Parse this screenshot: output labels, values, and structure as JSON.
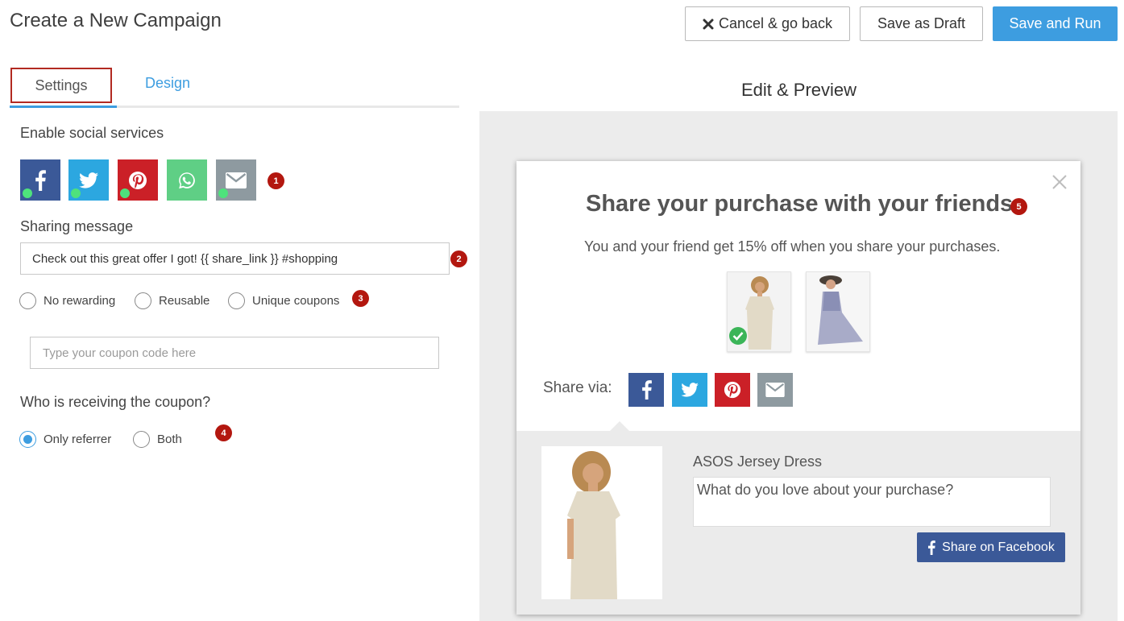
{
  "page": {
    "title": "Create a New Campaign"
  },
  "header": {
    "cancel_label": "Cancel & go back",
    "draft_label": "Save as Draft",
    "run_label": "Save and Run"
  },
  "tabs": [
    {
      "label": "Settings",
      "active": true
    },
    {
      "label": "Design",
      "active": false
    }
  ],
  "settings": {
    "social_label": "Enable social services",
    "social_services": [
      {
        "name": "facebook",
        "icon": "facebook-icon",
        "color": "#3b5998",
        "enabled": true
      },
      {
        "name": "twitter",
        "icon": "twitter-icon",
        "color": "#2ca7e0",
        "enabled": true
      },
      {
        "name": "pinterest",
        "icon": "pinterest-icon",
        "color": "#cb2027",
        "enabled": true
      },
      {
        "name": "whatsapp",
        "icon": "whatsapp-icon",
        "color": "#5fcf85",
        "enabled": false
      },
      {
        "name": "email",
        "icon": "envelope-icon",
        "color": "#8e9aa0",
        "enabled": true
      }
    ],
    "sharing_label": "Sharing message",
    "sharing_message": "Check out this great offer I got! {{ share_link }} #shopping",
    "reward_options": [
      "No rewarding",
      "Reusable",
      "Unique coupons"
    ],
    "reward_selected": null,
    "coupon_placeholder": "Type your coupon code here",
    "coupon_value": "",
    "receiver_label": "Who is receiving the coupon?",
    "receiver_options": [
      "Only referrer",
      "Both"
    ],
    "receiver_selected": "Only referrer"
  },
  "badges": [
    "1",
    "2",
    "3",
    "4",
    "5"
  ],
  "preview": {
    "title": "Edit & Preview",
    "popup_title": "Share your purchase with your friends",
    "popup_subtitle": "You and your friend get 15% off when you share your purchases.",
    "share_via_label": "Share via:",
    "share_buttons": [
      {
        "name": "facebook",
        "icon": "facebook-icon",
        "color": "#3b5998"
      },
      {
        "name": "twitter",
        "icon": "twitter-icon",
        "color": "#2ca7e0"
      },
      {
        "name": "pinterest",
        "icon": "pinterest-icon",
        "color": "#cb2027"
      },
      {
        "name": "email",
        "icon": "envelope-icon",
        "color": "#8e9aa0"
      }
    ],
    "product_name": "ASOS Jersey Dress",
    "review_placeholder": "What do you love about your purchase?",
    "share_facebook_label": "Share on Facebook"
  },
  "colors": {
    "accent": "#3d9de0",
    "badge": "#b3170f",
    "tab_outline": "#b22a21",
    "enabled_dot": "#4ee27c"
  }
}
